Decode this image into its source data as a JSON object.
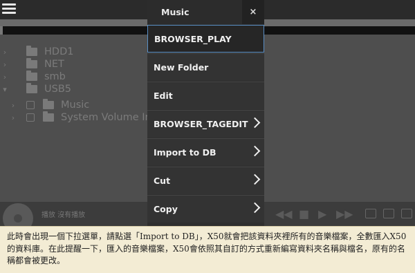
{
  "tree": {
    "items": [
      {
        "label": "HDD1",
        "chevron": "›"
      },
      {
        "label": "NET",
        "chevron": "›"
      },
      {
        "label": "smb",
        "chevron": "›"
      },
      {
        "label": "USB5",
        "chevron": "▾"
      },
      {
        "label": "Music",
        "chevron": "›"
      },
      {
        "label": "System Volume In",
        "chevron": "›"
      }
    ]
  },
  "player": {
    "now_playing": "播放  沒有播放"
  },
  "panel": {
    "title": "Music",
    "close_symbol": "×",
    "items": [
      {
        "label": "BROWSER_PLAY"
      },
      {
        "label": "New Folder"
      },
      {
        "label": "Edit"
      },
      {
        "label": "BROWSER_TAGEDIT"
      },
      {
        "label": "Import to DB"
      },
      {
        "label": "Cut"
      },
      {
        "label": "Copy"
      }
    ]
  },
  "caption": {
    "text": "此時會出現一個下拉選單，請點選「Import to DB」，X50就會把該資料夾裡所有的音樂檔案，全數匯入X50的資料庫。在此提醒一下，匯入的音樂檔案，X50會依照其自訂的方式重新編寫資料夾名稱與檔名，原有的名稱都會被更改。"
  },
  "colors": {
    "accent_border": "#5a8fc6",
    "caption_bg": "#f3ecd4"
  }
}
